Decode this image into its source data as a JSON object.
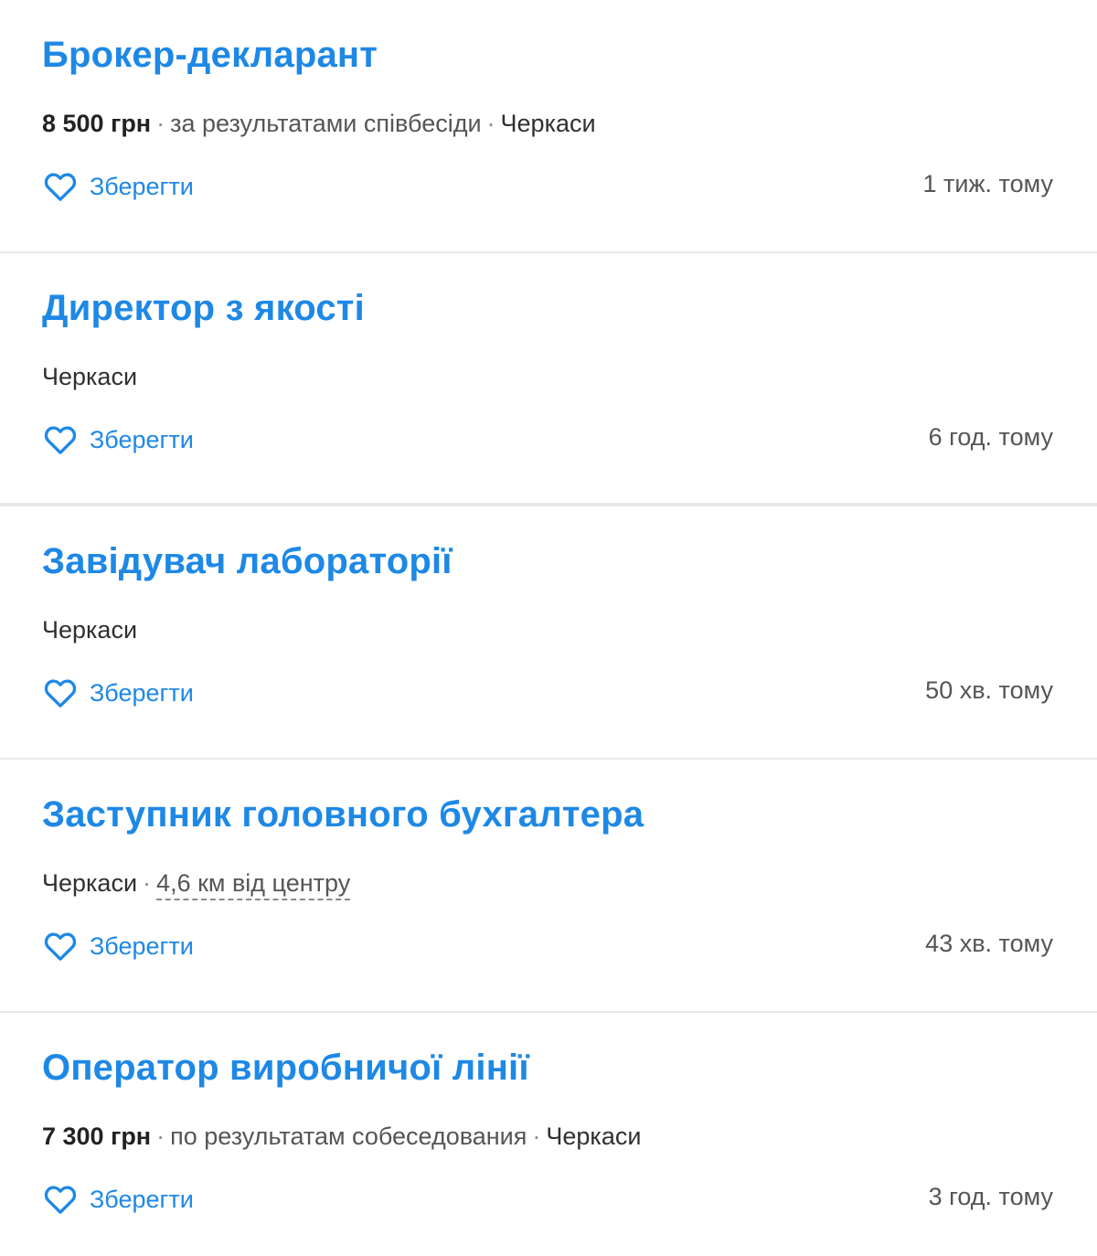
{
  "vacancies": [
    {
      "title": "Брокер-декларант",
      "salary": "8 500 грн",
      "salary_note": "за результатами співбесіди",
      "city": "Черкаси",
      "distance": "",
      "save_label": "Зберегти",
      "posted": "1 тиж. тому"
    },
    {
      "title": "Директор з якості",
      "salary": "",
      "salary_note": "",
      "city": "Черкаси",
      "distance": "",
      "save_label": "Зберегти",
      "posted": "6 год. тому"
    },
    {
      "title": "Завідувач лабораторії",
      "salary": "",
      "salary_note": "",
      "city": "Черкаси",
      "distance": "",
      "save_label": "Зберегти",
      "posted": "50 хв. тому"
    },
    {
      "title": "Заступник головного бухгалтера",
      "salary": "",
      "salary_note": "",
      "city": "Черкаси",
      "distance": "4,6 км від центру",
      "save_label": "Зберегти",
      "posted": "43 хв. тому"
    },
    {
      "title": "Оператор виробничої лінії",
      "salary": "7 300 грн",
      "salary_note": "по результатам собеседования",
      "city": "Черкаси",
      "distance": "",
      "save_label": "Зберегти",
      "posted": "3 год. тому"
    }
  ],
  "separator": "·",
  "icons": {
    "save": "heart-outline-icon"
  },
  "colors": {
    "accent": "#1e88e5",
    "text": "#303030",
    "muted": "#555555",
    "divider": "#e6e8eb"
  }
}
